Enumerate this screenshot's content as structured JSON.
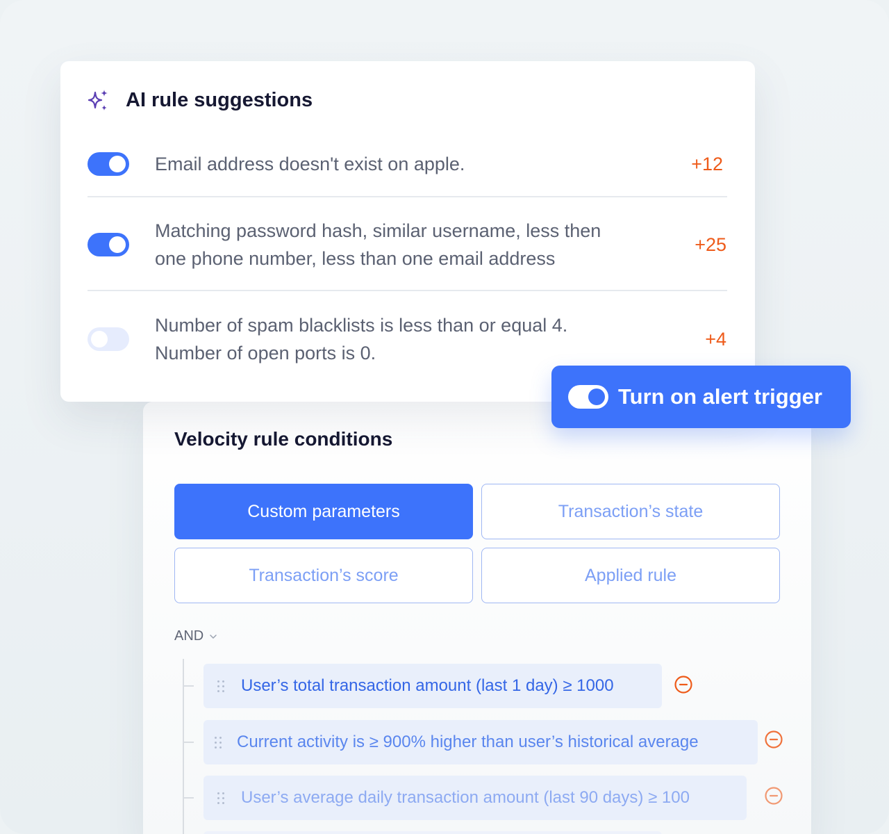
{
  "ai_suggestions": {
    "title": "AI rule suggestions",
    "icon": "sparkle-icon",
    "rules": [
      {
        "text_lines": [
          "Email address doesn't exist on apple."
        ],
        "score": "+12",
        "enabled": true
      },
      {
        "text_lines": [
          "Matching password hash, similar username, less then",
          "one phone number, less than one email address"
        ],
        "score": "+25",
        "enabled": true
      },
      {
        "text_lines": [
          "Number of spam blacklists is less than or equal 4.",
          "Number of open ports is 0."
        ],
        "score": "+4",
        "enabled": false
      }
    ]
  },
  "alert_trigger": {
    "label": "Turn on alert trigger",
    "enabled": true
  },
  "velocity": {
    "title": "Velocity rule conditions",
    "params": [
      {
        "label": "Custom parameters",
        "active": true
      },
      {
        "label": "Transaction’s state",
        "active": false
      },
      {
        "label": "Transaction’s score",
        "active": false
      },
      {
        "label": "Applied rule",
        "active": false
      }
    ],
    "operator": "AND",
    "conditions": [
      "User’s total transaction amount (last 1 day) ≥ 1000",
      "Current activity is ≥ 900% higher than user’s historical average",
      "User’s average daily transaction amount (last 90 days) ≥ 100"
    ]
  },
  "colors": {
    "accent": "#3d73fb",
    "score": "#ee5b1a",
    "toggle_off": "#e6ecfd",
    "remove": "#ee5b1a"
  }
}
